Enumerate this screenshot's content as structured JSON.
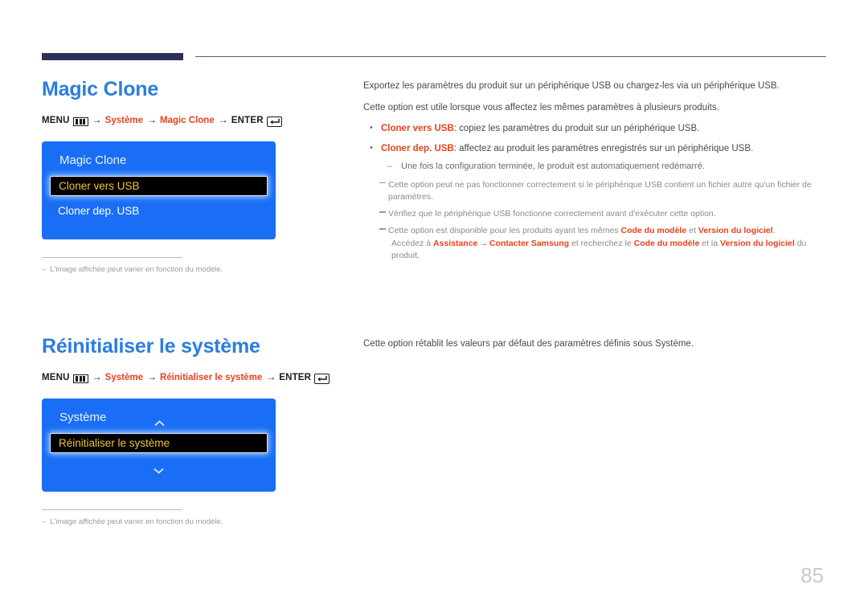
{
  "page": {
    "number": "85"
  },
  "sections": [
    {
      "heading": "Magic Clone",
      "breadcrumb": {
        "menu_label": "MENU",
        "menu_icon": "menu-grid-icon",
        "path1": "Système",
        "path2": "Magic Clone",
        "enter_label": "ENTER",
        "enter_icon": "enter-return-icon",
        "arrow": "→"
      },
      "tv_menu": {
        "title": "Magic Clone",
        "selected_item": "Cloner vers USB",
        "items": [
          "Cloner dep. USB"
        ],
        "chevron_up": false,
        "chevron_down": false
      },
      "footnote": {
        "dash": "‒",
        "text": "L'image affichée peut varier en fonction du modèle."
      },
      "body": {
        "paragraphs": [
          "Exportez les paramètres du produit sur un périphérique USB ou chargez-les via un périphérique USB.",
          "Cette option est utile lorsque vous affectez les mêmes paramètres à plusieurs produits."
        ],
        "bullets": [
          {
            "marker": "•",
            "strong": "Cloner vers USB",
            "rest": ": copiez les paramètres du produit sur un périphérique USB."
          },
          {
            "marker": "•",
            "strong": "Cloner dep. USB",
            "rest": ": affectez au produit les paramètres enregistrés sur un périphérique USB."
          }
        ],
        "sub_items": [
          {
            "marker": "–",
            "text": "Une fois la configuration terminée, le produit est automatiquement redémarré."
          }
        ],
        "notes": [
          {
            "text": "Cette option peut ne pas fonctionner correctement si le périphérique USB contient un fichier autre qu'un fichier de paramètres."
          },
          {
            "text": "Vérifiez que le périphérique USB fonctionne correctement avant d'exécuter cette option."
          }
        ],
        "note_rich": {
          "line1_pre": "Cette option est disponible pour les produits ayant les mêmes ",
          "line1_b1": "Code du modèle",
          "line1_mid": " et ",
          "line1_b2": "Version du logiciel",
          "line1_end": ".",
          "line2_pre": "Accédez à ",
          "line2_b1": "Assistance",
          "line2_arrow": "→",
          "line2_b2": "Contacter Samsung",
          "line2_mid": " et recherchez le ",
          "line2_b3": "Code du modèle",
          "line2_mid2": " et la ",
          "line2_b4": "Version du logiciel",
          "line2_end": " du produit."
        }
      }
    },
    {
      "heading": "Réinitialiser le système",
      "breadcrumb": {
        "menu_label": "MENU",
        "menu_icon": "menu-grid-icon",
        "path1": "Système",
        "path2": "Réinitialiser le système",
        "enter_label": "ENTER",
        "enter_icon": "enter-return-icon",
        "arrow": "→"
      },
      "tv_menu": {
        "title": "Système",
        "selected_item": "Réinitialiser le système",
        "items": [],
        "chevron_up": true,
        "chevron_down": true
      },
      "footnote": {
        "dash": "‒",
        "text": "L'image affichée peut varier en fonction du modèle."
      },
      "body": {
        "paragraphs": [
          "Cette option rétablit les valeurs par défaut des paramètres définis sous Système."
        ]
      }
    }
  ],
  "colors": {
    "heading_blue": "#2b7de0",
    "accent_orange": "#e8411c",
    "tv_blue": "#1a6ef5",
    "selected_text": "#f2c23a",
    "rule_navy": "#2e3157"
  }
}
